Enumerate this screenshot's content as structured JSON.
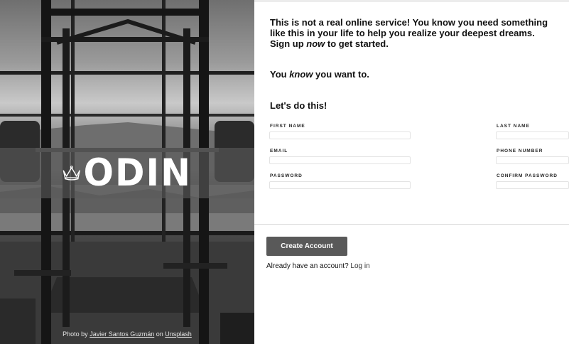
{
  "brand": {
    "wordmark": "ODIN",
    "logo_icon": "crown-icon"
  },
  "photo_credit": {
    "prefix": "Photo by",
    "author": "Javier Santos Guzmán",
    "middle": "on",
    "site": "Unsplash"
  },
  "intro": {
    "text_before": "This is not a real online service! You know you need something like this in your life to help you realize your deepest dreams. Sign up ",
    "emphasis": "now",
    "text_after": " to get started."
  },
  "tagline": {
    "before": "You ",
    "emphasis": "know",
    "after": " you want to."
  },
  "form": {
    "heading": "Let's do this!",
    "fields": {
      "first_name": {
        "label": "FIRST NAME",
        "value": ""
      },
      "last_name": {
        "label": "LAST NAME",
        "value": ""
      },
      "email": {
        "label": "EMAIL",
        "value": ""
      },
      "phone": {
        "label": "PHONE NUMBER",
        "value": ""
      },
      "password": {
        "label": "PASSWORD",
        "value": ""
      },
      "confirm_password": {
        "label": "CONFIRM PASSWORD",
        "value": ""
      }
    },
    "submit_label": "Create Account",
    "login_prompt": "Already have an account?",
    "login_link": "Log in"
  },
  "colors": {
    "button_bg": "#595959",
    "logo_band": "#5a5a5a",
    "text": "#111111"
  }
}
